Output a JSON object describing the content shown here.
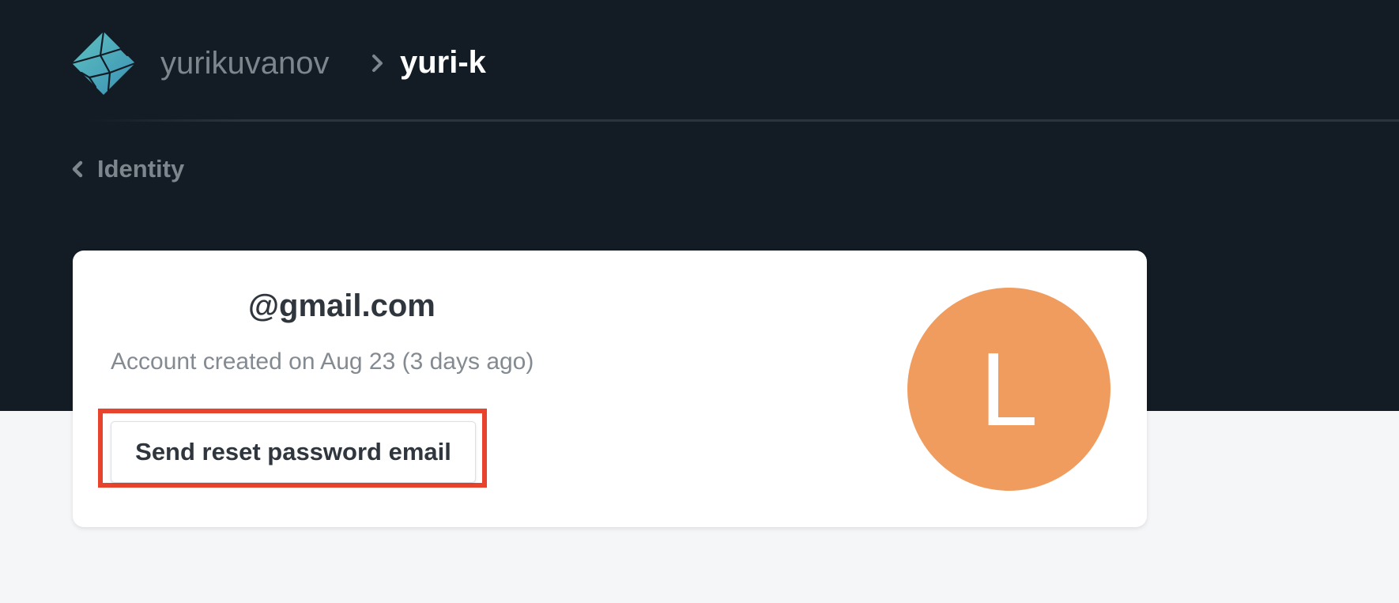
{
  "header": {
    "team_name": "yurikuvanov",
    "site_name": "yuri-k",
    "logo_icon": "netlify-logo-icon",
    "separator_icon": "chevron-right-icon"
  },
  "nav": {
    "back_label": "Identity",
    "back_icon": "chevron-left-icon"
  },
  "user": {
    "email": "@gmail.com",
    "created_text": "Account created on Aug 23 (3 days ago)",
    "reset_button_label": "Send reset password email",
    "avatar_initial": "L",
    "avatar_color": "#f19c5f"
  },
  "colors": {
    "header_background": "#131c24",
    "page_background": "#f5f6f8",
    "highlight_border": "#e8442d"
  }
}
